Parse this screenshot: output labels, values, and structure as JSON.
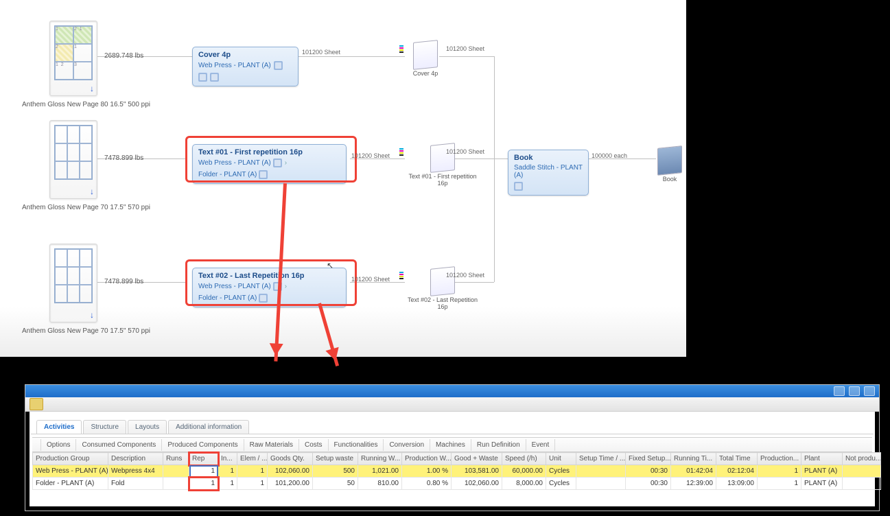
{
  "materials": [
    {
      "label": "Anthem Gloss New Page 80 16.5\" 500 ppi",
      "lbs": "2689.748 lbs"
    },
    {
      "label": "Anthem Gloss New Page 70 17.5\" 570 ppi",
      "lbs": "7478.899 lbs"
    },
    {
      "label": "Anthem Gloss New Page 70 17.5\" 570 ppi",
      "lbs": "7478.899 lbs"
    }
  ],
  "nodes": {
    "cover": {
      "title": "Cover 4p",
      "plant": "Web Press - PLANT (A)",
      "out": "101200 Sheet"
    },
    "text1": {
      "title": "Text #01 - First repetition 16p",
      "plant": "Web Press - PLANT (A)",
      "folder": "Folder - PLANT (A)",
      "out": "101200 Sheet"
    },
    "text2": {
      "title": "Text #02 - Last Repetition 16p",
      "plant": "Web Press - PLANT (A)",
      "folder": "Folder - PLANT (A)",
      "out": "101200 Sheet"
    },
    "book": {
      "title": "Book",
      "plant": "Saddle Stitch - PLANT (A)",
      "out": "100000 each"
    }
  },
  "components": {
    "cover": {
      "label": "Cover 4p",
      "out": "101200 Sheet"
    },
    "text1": {
      "label": "Text #01 - First repetition 16p",
      "out": "101200 Sheet"
    },
    "text2": {
      "label": "Text #02 - Last Repetition 16p",
      "out": "101200 Sheet"
    },
    "book": {
      "label": "Book"
    }
  },
  "tabs": [
    "Activities",
    "Structure",
    "Layouts",
    "Additional information"
  ],
  "subtabs": [
    "Options",
    "Consumed Components",
    "Produced Components",
    "Raw Materials",
    "Costs",
    "Functionalities",
    "Conversion",
    "Machines",
    "Run Definition",
    "Event"
  ],
  "columns": [
    "Production Group",
    "Description",
    "Runs",
    "Rep",
    "In...",
    "Elem / ...",
    "Goods Qty.",
    "Setup waste",
    "Running W...",
    "Production W...",
    "Good + Waste",
    "Speed (/h)",
    "Unit",
    "Setup Time / ...",
    "Fixed Setup...",
    "Running Ti...",
    "Total Time",
    "Production...",
    "Plant",
    "Not produ..."
  ],
  "rows": [
    {
      "group": "Web Press - PLANT (A)",
      "desc": "Webpress 4x4",
      "runs": "",
      "rep": "1",
      "in": "1",
      "elem": "1",
      "goods": "102,060.00",
      "setup": "500",
      "runw": "1,021.00",
      "prodw": "1.00 %",
      "goodw": "103,581.00",
      "speed": "60,000.00",
      "unit": "Cycles",
      "setupt": "",
      "fixed": "00:30",
      "runt": "01:42:04",
      "total": "02:12:04",
      "prod": "1",
      "plant": "PLANT (A)",
      "np": ""
    },
    {
      "group": "Folder - PLANT (A)",
      "desc": "Fold",
      "runs": "",
      "rep": "1",
      "in": "1",
      "elem": "1",
      "goods": "101,200.00",
      "setup": "50",
      "runw": "810.00",
      "prodw": "0.80 %",
      "goodw": "102,060.00",
      "speed": "8,000.00",
      "unit": "Cycles",
      "setupt": "",
      "fixed": "00:30",
      "runt": "12:39:00",
      "total": "13:09:00",
      "prod": "1",
      "plant": "PLANT (A)",
      "np": ""
    }
  ]
}
